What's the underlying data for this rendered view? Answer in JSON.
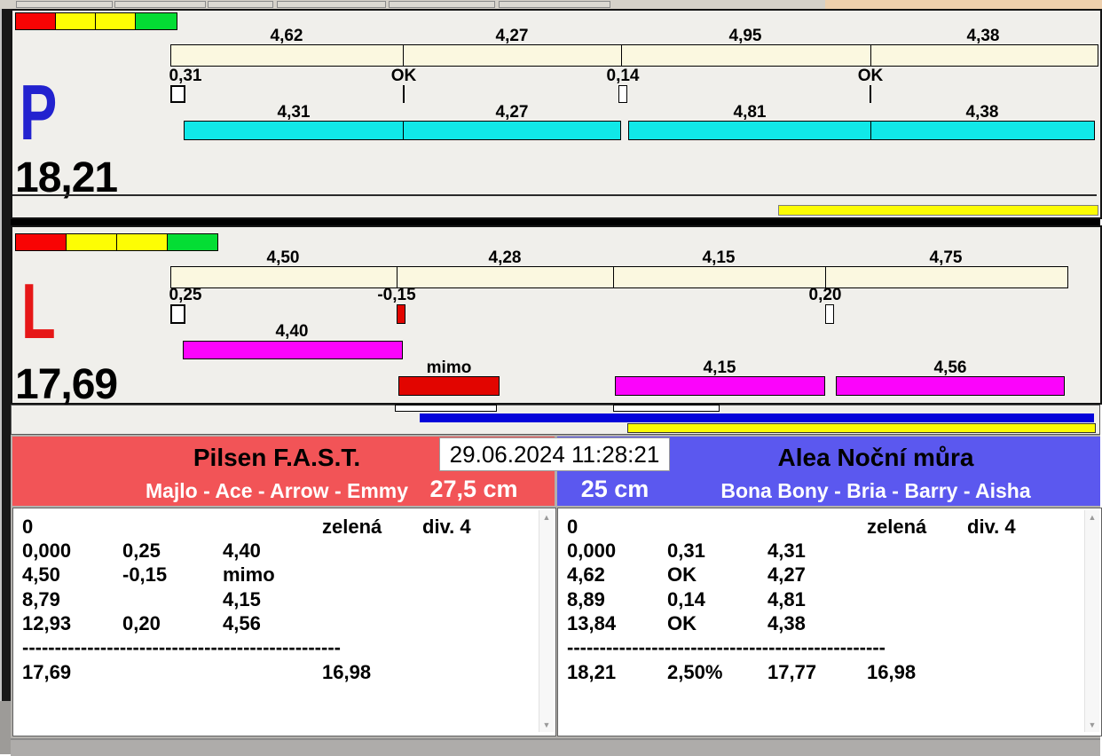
{
  "datetime": "29.06.2024 11:28:21",
  "lane_p": {
    "label": "P",
    "label_color": "#2222cf",
    "total": "18,21",
    "lights": [
      "#f80404",
      "#fdfd04",
      "#fdfd04",
      "#04dd34"
    ],
    "legs": [
      "4,62",
      "4,27",
      "4,95",
      "4,38"
    ],
    "changes": [
      "0,31",
      "OK",
      "0,14",
      "OK"
    ],
    "splits": [
      "4,31",
      "4,27",
      "4,81",
      "4,38"
    ]
  },
  "lane_l": {
    "label": "L",
    "label_color": "#e61717",
    "total": "17,69",
    "lights": [
      "#f80404",
      "#fdfd04",
      "#fdfd04",
      "#04dd34"
    ],
    "legs": [
      "4,50",
      "4,28",
      "4,15",
      "4,75"
    ],
    "changes": [
      "0,25",
      "-0,15",
      "0,20"
    ],
    "splits": [
      "4,40",
      "mimo",
      "4,15",
      "4,56"
    ]
  },
  "team_left": {
    "name": "Pilsen F.A.S.T.",
    "members": "Majlo - Ace - Arrow - Emmy",
    "jump_height": "27,5 cm",
    "header_color": "#f25457",
    "run": {
      "start": "0",
      "card": "zelená",
      "division": "div. 4",
      "rows": [
        [
          "0,000",
          "0,25",
          "4,40"
        ],
        [
          "4,50",
          "-0,15",
          "mimo"
        ],
        [
          "8,79",
          "",
          "4,15"
        ],
        [
          "12,93",
          "0,20",
          "4,56"
        ]
      ],
      "separator": "-------------------------------------------------",
      "total": "17,69",
      "best": "16,98"
    }
  },
  "team_right": {
    "name": "Alea Noční můra",
    "members": "Bona Bony - Bria - Barry - Aisha",
    "jump_height": "25 cm",
    "header_color": "#5b58ef",
    "run": {
      "start": "0",
      "card": "zelená",
      "division": "div. 4",
      "rows": [
        [
          "0,000",
          "0,31",
          "4,31"
        ],
        [
          "4,62",
          "OK",
          "4,27"
        ],
        [
          "8,89",
          "0,14",
          "4,81"
        ],
        [
          "13,84",
          "OK",
          "4,38"
        ]
      ],
      "separator": "-------------------------------------------------",
      "total": "18,21",
      "percent": "2,50%",
      "adjusted": "17,77",
      "best": "16,98"
    }
  },
  "colors": {
    "cream_bar": "#fbf8e0",
    "split_bar_p": "#10e8e8",
    "split_bar_l": "#fb04fb",
    "fault_bar": "#e20500",
    "progress_blue": "#0404da",
    "progress_yellow": "#fcfc04",
    "background_panel": "#f0efeb",
    "background_gray": "#b3b1ad"
  }
}
